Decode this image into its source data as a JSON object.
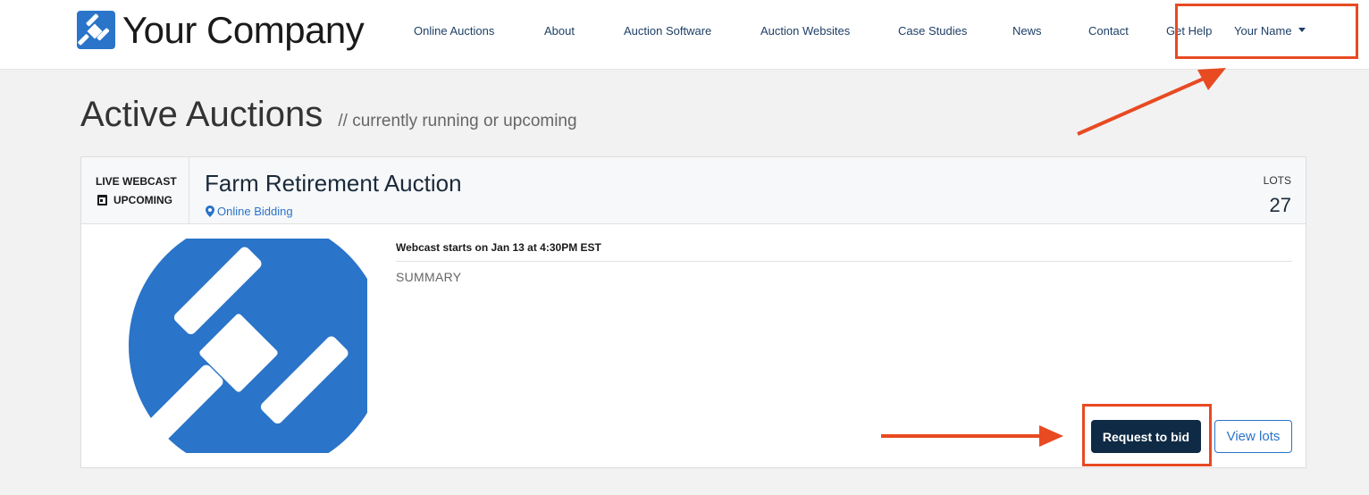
{
  "brand": {
    "name": "Your Company",
    "color": "#2a74c9"
  },
  "nav": {
    "items": [
      "Online Auctions",
      "About",
      "Auction Software",
      "Auction Websites",
      "Case Studies",
      "News",
      "Contact",
      "Get Help"
    ],
    "user": "Your Name"
  },
  "page": {
    "title": "Active Auctions",
    "subtitle": "// currently running or upcoming"
  },
  "auction": {
    "type_label": "LIVE WEBCAST",
    "status": "UPCOMING",
    "title": "Farm Retirement Auction",
    "location": "Online Bidding",
    "lots_label": "LOTS",
    "lots_count": "27",
    "webcast": "Webcast starts on Jan 13 at 4:30PM EST",
    "summary_label": "SUMMARY",
    "request_button": "Request to bid",
    "view_button": "View lots"
  },
  "colors": {
    "annotation": "#e84a22",
    "primary_button": "#0f2a45",
    "link": "#2a74c9",
    "background": "#f2f2f2"
  }
}
